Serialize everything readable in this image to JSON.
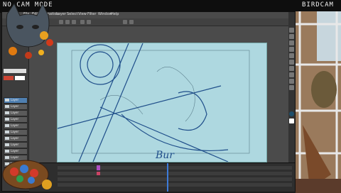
{
  "stream": {
    "mode_label": "NO CAM MODE",
    "birdcam_label": "BIRDCAM"
  },
  "menu": [
    "File",
    "Edit",
    "Animation",
    "Layer",
    "Select",
    "View",
    "Filter",
    "Window",
    "Help"
  ],
  "layers": [
    {
      "label": "Layer"
    },
    {
      "label": "Layer"
    },
    {
      "label": "Layer"
    },
    {
      "label": "Layer"
    },
    {
      "label": "Layer"
    },
    {
      "label": "Layer"
    },
    {
      "label": "Layer"
    },
    {
      "label": "Layer"
    },
    {
      "label": "Layer"
    },
    {
      "label": "Layer"
    },
    {
      "label": "Layer"
    },
    {
      "label": "Layer"
    }
  ],
  "canvas_text": "Bur",
  "colors": {
    "accent": "#3d7bd9",
    "canvas": "#aed8e0",
    "sketch": "#1f4e8a"
  },
  "icons": [
    "cat-icon",
    "nest-icon",
    "pencil-icon",
    "eraser-icon",
    "brush-icon",
    "fill-icon",
    "select-icon",
    "move-icon",
    "zoom-icon",
    "hand-icon"
  ]
}
